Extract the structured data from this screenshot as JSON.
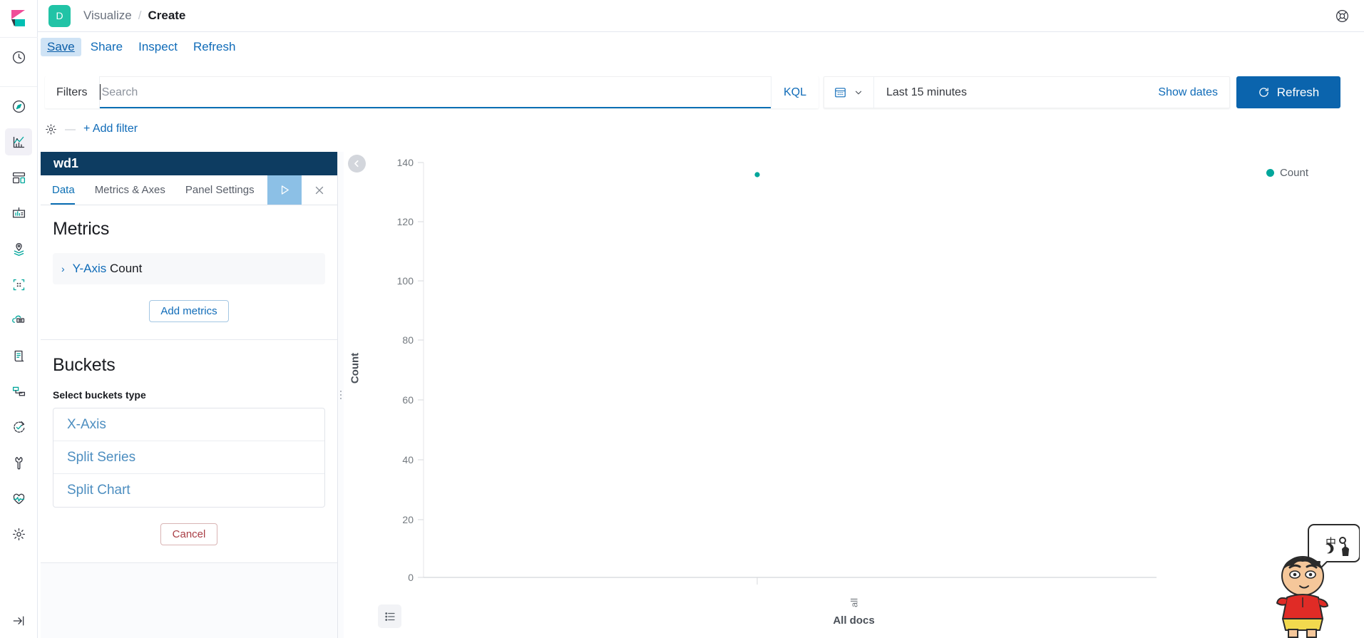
{
  "header": {
    "logo_icon": "elastic-kibana-logo",
    "space_initial": "D",
    "breadcrumbs": [
      {
        "label": "Visualize",
        "current": false
      },
      {
        "label": "Create",
        "current": true
      }
    ],
    "separator": "/",
    "help_icon": "lifebuoy-help-icon"
  },
  "nav_rail": {
    "items": [
      {
        "icon": "recently-viewed-clock-icon",
        "name": "recently-viewed",
        "active": false,
        "group": "top"
      },
      {
        "icon": "discover-compass-icon",
        "name": "discover",
        "active": false,
        "group": "main"
      },
      {
        "icon": "visualize-chart-icon",
        "name": "visualize",
        "active": true,
        "group": "main"
      },
      {
        "icon": "dashboard-grid-icon",
        "name": "dashboard",
        "active": false,
        "group": "main"
      },
      {
        "icon": "canvas-presentation-icon",
        "name": "canvas",
        "active": false,
        "group": "main"
      },
      {
        "icon": "maps-layers-pin-icon",
        "name": "maps",
        "active": false,
        "group": "main"
      },
      {
        "icon": "machine-learning-icon",
        "name": "machine-learning",
        "active": false,
        "group": "main"
      },
      {
        "icon": "infrastructure-server-icon",
        "name": "infrastructure",
        "active": false,
        "group": "main"
      },
      {
        "icon": "logs-scroll-icon",
        "name": "logs",
        "active": false,
        "group": "main"
      },
      {
        "icon": "apm-flow-icon",
        "name": "apm",
        "active": false,
        "group": "main"
      },
      {
        "icon": "uptime-refresh-check-icon",
        "name": "uptime",
        "active": false,
        "group": "main"
      },
      {
        "icon": "dev-tools-wrench-icon",
        "name": "dev-tools",
        "active": false,
        "group": "main"
      },
      {
        "icon": "monitoring-heartbeat-icon",
        "name": "monitoring",
        "active": false,
        "group": "main"
      },
      {
        "icon": "management-gear-icon",
        "name": "management",
        "active": false,
        "group": "main"
      }
    ],
    "collapse_icon": "arrow-right-collapse-icon"
  },
  "action_bar": {
    "items": [
      {
        "label": "Save",
        "focused": true
      },
      {
        "label": "Share",
        "focused": false
      },
      {
        "label": "Inspect",
        "focused": false
      },
      {
        "label": "Refresh",
        "focused": false
      }
    ]
  },
  "query_bar": {
    "filters_label": "Filters",
    "search_value": "",
    "search_placeholder": "Search",
    "language_label": "KQL",
    "calendar_icon": "calendar-icon",
    "chevron_icon": "chevron-down-icon",
    "time_range": "Last 15 minutes",
    "show_dates_label": "Show dates",
    "refresh_label": "Refresh",
    "refresh_icon": "refresh-circle-icon"
  },
  "filter_bar": {
    "gear_icon": "gear-icon",
    "dash": "—",
    "add_filter_label": "+ Add filter"
  },
  "editor": {
    "title": "wd1",
    "tabs": [
      {
        "label": "Data",
        "active": true
      },
      {
        "label": "Metrics & Axes",
        "active": false
      },
      {
        "label": "Panel Settings",
        "active": false
      }
    ],
    "apply_icon": "play-apply-icon",
    "close_icon": "close-x-icon",
    "metrics": {
      "heading": "Metrics",
      "rows": [
        {
          "chevron": "›",
          "agg_name": "Y-Axis",
          "agg_value": "Count"
        }
      ],
      "add_button": "Add metrics"
    },
    "buckets": {
      "heading": "Buckets",
      "select_label": "Select buckets type",
      "types": [
        {
          "label": "X-Axis"
        },
        {
          "label": "Split Series"
        },
        {
          "label": "Split Chart"
        }
      ],
      "cancel_button": "Cancel"
    },
    "resize_handle_icon": "drag-vertical-dots-icon",
    "collapse_icon": "chevron-left-circle-icon"
  },
  "chart_panel": {
    "toolbar_icon": "list-inspect-icon"
  },
  "overlay": {
    "cartoon_name": "shinchan-cartoon-overlay"
  },
  "chart_data": {
    "type": "scatter",
    "title": "",
    "subtitle": "",
    "xlabel": "All docs",
    "ylabel": "Count",
    "categories": [
      "all"
    ],
    "x_tick_labels": [
      "all"
    ],
    "y_ticks": [
      0,
      20,
      40,
      60,
      80,
      100,
      120,
      140
    ],
    "ylim": [
      0,
      140
    ],
    "grid": false,
    "legend_position": "top-right",
    "series": [
      {
        "name": "Count",
        "color": "#00a69b",
        "values": [
          136
        ]
      }
    ],
    "legend": [
      {
        "label": "Count",
        "color": "#00a69b"
      }
    ]
  },
  "colors": {
    "brand_blue": "#0b64ad",
    "link_blue": "#0f6bb8",
    "panel_header": "#0d3c61",
    "accent_teal": "#00a69b",
    "space_avatar": "#21c3a6",
    "danger": "#a93e45"
  }
}
